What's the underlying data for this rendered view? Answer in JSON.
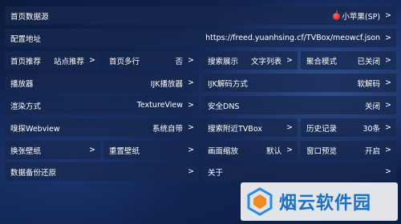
{
  "rows": [
    {
      "cells": [
        {
          "label": "首页数据源",
          "value": "小苹果(SP)",
          "arrow": ">",
          "fruit": true
        }
      ]
    },
    {
      "cells": [
        {
          "label": "配置地址",
          "value": "https://freed.yuanhsing.cf/TVBox/meowcf.json",
          "arrow": ">"
        }
      ]
    },
    {
      "cells": [
        {
          "label": "首页推荐",
          "value": "站点推荐",
          "arrow": ">"
        },
        {
          "label": "首页多行",
          "value": "否",
          "arrow": ">"
        },
        {
          "label": "搜索展示",
          "value": "文字列表",
          "arrow": ">"
        },
        {
          "label": "聚合模式",
          "value": "已关闭",
          "arrow": ">"
        }
      ]
    },
    {
      "cells": [
        {
          "label": "播放器",
          "value": "IJK播放器",
          "arrow": ">"
        },
        {
          "label": "IJK解码方式",
          "value": "软解码",
          "arrow": ">"
        }
      ]
    },
    {
      "cells": [
        {
          "label": "渲染方式",
          "value": "TextureView",
          "arrow": ">"
        },
        {
          "label": "安全DNS",
          "value": "关闭",
          "arrow": ">"
        }
      ]
    },
    {
      "cells": [
        {
          "label": "嗅探Webview",
          "value": "系统自带",
          "arrow": ">"
        },
        {
          "label": "搜索附近TVBox",
          "value": "",
          "arrow": ">"
        },
        {
          "label": "历史记录",
          "value": "30条",
          "arrow": ">"
        }
      ]
    },
    {
      "cells": [
        {
          "label": "换张壁纸",
          "value": "",
          "arrow": ">"
        },
        {
          "label": "重置壁纸",
          "value": "",
          "arrow": ">"
        },
        {
          "label": "画面缩放",
          "value": "默认",
          "arrow": ">"
        },
        {
          "label": "窗口预览",
          "value": "开启",
          "arrow": ">"
        }
      ]
    },
    {
      "cells": [
        {
          "label": "数据备份还原",
          "value": "",
          "arrow": ">"
        },
        {
          "label": "关于",
          "value": "",
          "arrow": ">"
        }
      ]
    }
  ],
  "watermark": {
    "text": "烟云软件园"
  }
}
